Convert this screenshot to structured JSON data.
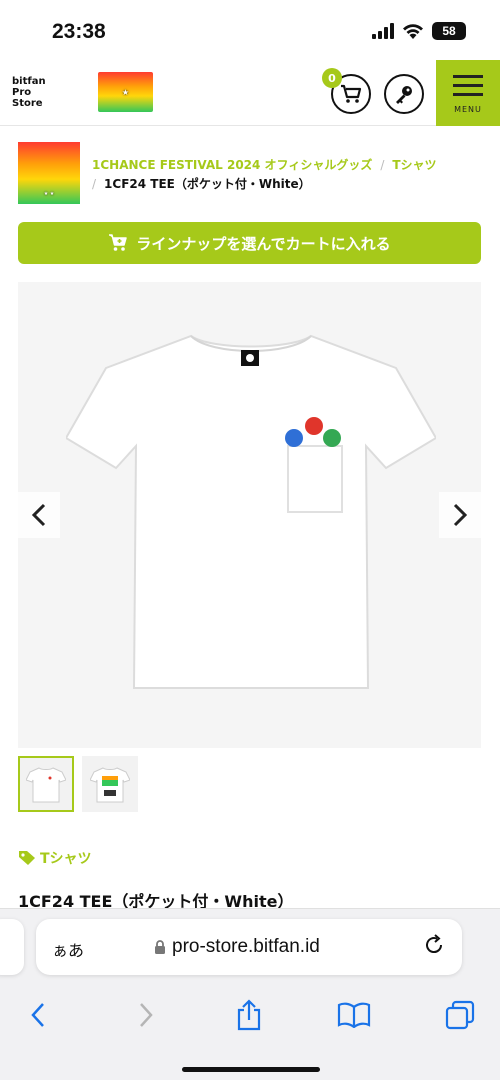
{
  "status": {
    "time": "23:38",
    "battery": "58"
  },
  "header": {
    "brand_line1": "bitfan",
    "brand_line2": "Pro",
    "brand_line3": "Store",
    "cart_count": "0",
    "menu_label": "MENU"
  },
  "breadcrumb": {
    "event": "1CHANCE FESTIVAL 2024 オフィシャルグッズ",
    "sep": "/",
    "category": "Tシャツ",
    "current": "1CF24 TEE（ポケット付・White）"
  },
  "cta": {
    "label": "ラインナップを選んでカートに入れる"
  },
  "product": {
    "category_tag": "Tシャツ",
    "title": "1CF24 TEE（ポケット付・White）"
  },
  "browser": {
    "aa": "ぁあ",
    "url": "pro-store.bitfan.id"
  },
  "colors": {
    "accent": "#a6c91a",
    "ios_blue": "#1a73e8"
  }
}
